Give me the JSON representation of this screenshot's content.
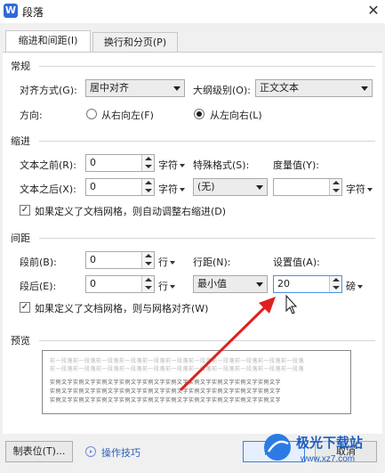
{
  "window": {
    "title": "段落",
    "app_icon_letter": "W",
    "close_glyph": "✕"
  },
  "tabs": [
    {
      "label": "缩进和间距(I)",
      "active": true
    },
    {
      "label": "换行和分页(P)",
      "active": false
    }
  ],
  "general": {
    "heading": "常规",
    "alignment_label": "对齐方式(G):",
    "alignment_value": "居中对齐",
    "outline_label": "大纲级别(O):",
    "outline_value": "正文文本",
    "direction_label": "方向:",
    "direction_rtl": "从右向左(F)",
    "direction_ltr": "从左向右(L)",
    "direction_selected": "ltr"
  },
  "indent": {
    "heading": "缩进",
    "before_label": "文本之前(R):",
    "before_value": "0",
    "before_unit": "字符",
    "after_label": "文本之后(X):",
    "after_value": "0",
    "after_unit": "字符",
    "special_label": "特殊格式(S):",
    "special_value": "(无)",
    "measure_label": "度量值(Y):",
    "measure_value": "",
    "measure_unit": "字符",
    "auto_adjust_label": "如果定义了文档网格，则自动调整右缩进(D)",
    "auto_adjust_checked": true
  },
  "spacing": {
    "heading": "间距",
    "before_label": "段前(B):",
    "before_value": "0",
    "before_unit": "行",
    "after_label": "段后(E):",
    "after_value": "0",
    "after_unit": "行",
    "line_label": "行距(N):",
    "line_value": "最小值",
    "setting_label": "设置值(A):",
    "setting_value": "20",
    "setting_unit": "磅",
    "snap_grid_label": "如果定义了文档网格，则与网格对齐(W)",
    "snap_grid_checked": true
  },
  "preview": {
    "heading": "预览",
    "lines": [
      {
        "text": "前一段落前一段落前一段落前一段落前一段落前一段落前一段落前一段落前一段落前一段落前一段落",
        "tone": "gray"
      },
      {
        "text": "前一段落前一段落前一段落前一段落前一段落前一段落前一段落前一段落前一段落前一段落前一段落",
        "tone": "gray"
      },
      {
        "text": "实例文字实例文字实例文字实例文字实例文字实例文字实例文字实例文字实例文字实例文字",
        "tone": "dark"
      },
      {
        "text": "实例文字实例文字实例文字实例文字实例文字实例文字实例文字实例文字实例文字实例文字",
        "tone": "dark"
      },
      {
        "text": "实例文字实例文字实例文字实例文字实例文字实例文字实例文字实例文字实例文字实例文字",
        "tone": "dark"
      }
    ]
  },
  "footer": {
    "tabs_button": "制表位(T)...",
    "tips_link": "操作技巧",
    "ok_button": "确定",
    "cancel_button": "取消"
  },
  "watermark": {
    "text": "极光下载站",
    "url": "www.xz7.com"
  },
  "colors": {
    "accent": "#2e6bd9",
    "focus_border": "#4a90e2",
    "annotation_arrow": "#e02020"
  }
}
